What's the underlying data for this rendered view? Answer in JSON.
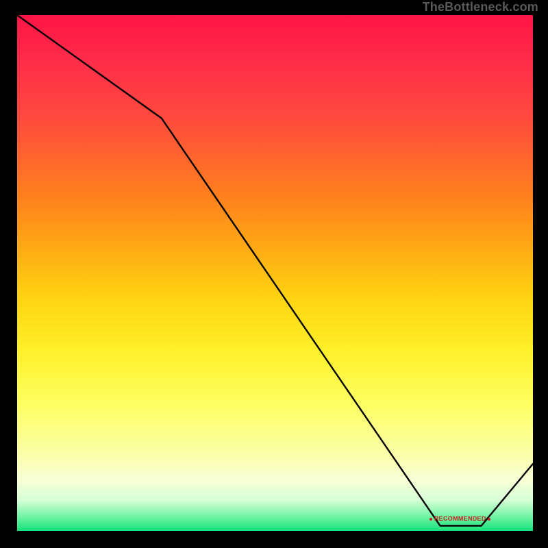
{
  "watermark": "TheBottleneck.com",
  "annotation_label": "RECOMMENDED",
  "chart_data": {
    "type": "line",
    "title": "",
    "xlabel": "",
    "ylabel": "",
    "xlim": [
      0,
      100
    ],
    "ylim": [
      0,
      100
    ],
    "series": [
      {
        "name": "bottleneck-curve",
        "x": [
          0,
          28,
          82,
          90,
          100
        ],
        "y": [
          100,
          80,
          1,
          1,
          13
        ]
      }
    ],
    "recommended_band": {
      "x_start": 78,
      "x_end": 92,
      "y": 2
    }
  }
}
